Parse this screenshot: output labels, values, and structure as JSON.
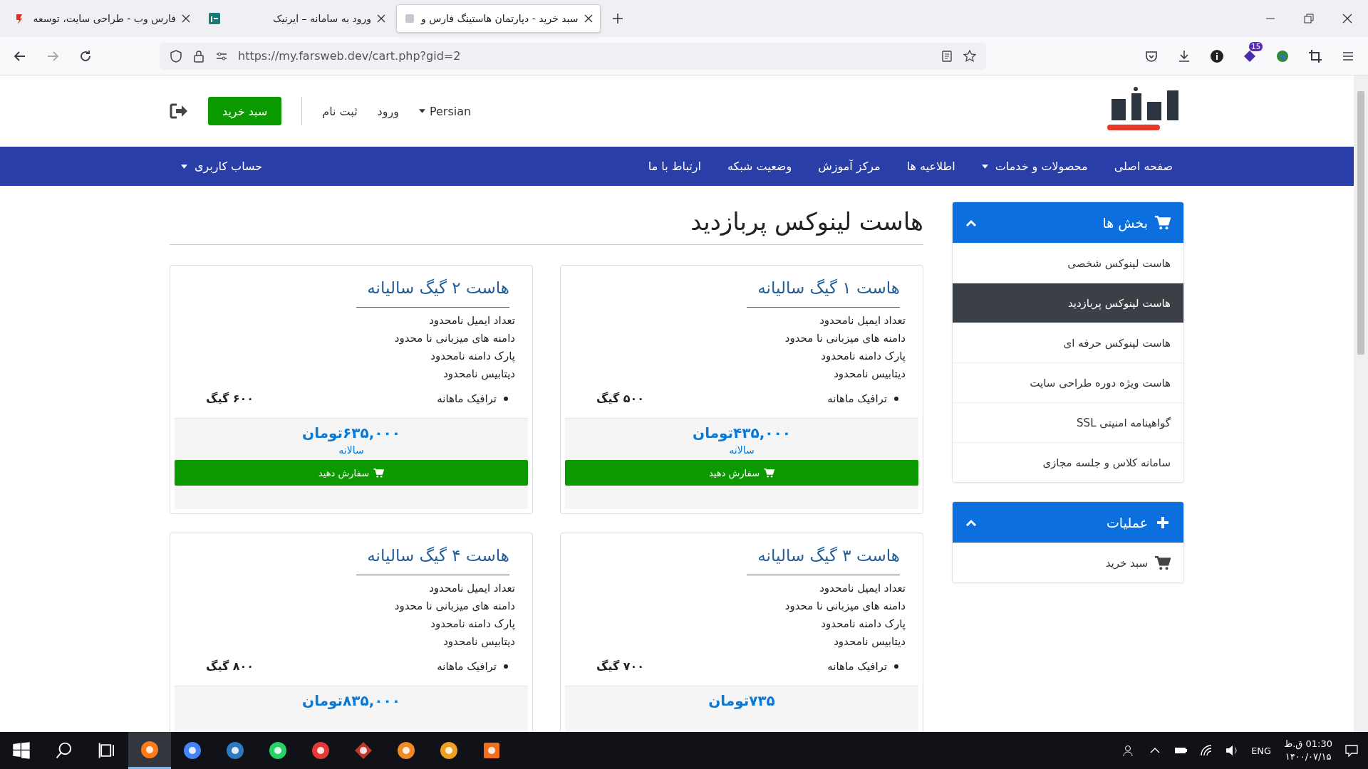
{
  "browser": {
    "tabs": [
      {
        "title": "سبد خرید - دپارتمان هاستینگ فارس و",
        "selected": true
      },
      {
        "title": "ورود به سامانه – ایرنیک",
        "selected": false
      },
      {
        "title": "فارس وب - طراحی سایت، توسعه",
        "selected": false
      }
    ],
    "url": "https://my.farsweb.dev/cart.php?gid=2",
    "extension_badge": "15"
  },
  "header": {
    "language": "Persian",
    "login": "ورود",
    "register": "ثبت نام",
    "cart_button": "سبد خرید"
  },
  "nav": {
    "items": [
      {
        "label": "صفحه اصلی",
        "dropdown": false
      },
      {
        "label": "محصولات و خدمات",
        "dropdown": true
      },
      {
        "label": "اطلاعیه ها",
        "dropdown": false
      },
      {
        "label": "مرکز آموزش",
        "dropdown": false
      },
      {
        "label": "وضعیت شبکه",
        "dropdown": false
      },
      {
        "label": "ارتباط با ما",
        "dropdown": false
      }
    ],
    "account": {
      "label": "حساب کاربری",
      "dropdown": true
    }
  },
  "sidebar": [
    {
      "title": "بخش ها",
      "kind": "cart",
      "items": [
        {
          "label": "هاست لینوکس شخصی",
          "selected": false
        },
        {
          "label": "هاست لینوکس پربازدید",
          "selected": true
        },
        {
          "label": "هاست لینوکس حرفه ای",
          "selected": false
        },
        {
          "label": "هاست ویژه دوره طراحی سایت",
          "selected": false
        },
        {
          "label": "گواهینامه امنیتی SSL",
          "selected": false
        },
        {
          "label": "سامانه کلاس و جلسه مجازی",
          "selected": false
        }
      ]
    },
    {
      "title": "عملیات",
      "kind": "plus",
      "items": [
        {
          "label": "سبد خرید",
          "kind": "cart",
          "selected": false
        }
      ]
    }
  ],
  "page_title": "هاست لینوکس پربازدید",
  "products": [
    {
      "name": "هاست ۱ گیگ سالیانه",
      "features": [
        "تعداد ایمیل نامحدود",
        "دامنه های میزبانی نا محدود",
        "پارک دامنه نامحدود",
        "دیتابیس نامحدود"
      ],
      "traffic_label": "ترافیک ماهانه",
      "traffic_value": "۵۰۰ گیگ",
      "price": "۴۳۵,۰۰۰تومان",
      "cycle": "سالانه",
      "order_button": "سفارش دهید"
    },
    {
      "name": "هاست ۲ گیگ سالیانه",
      "features": [
        "تعداد ایمیل نامحدود",
        "دامنه های میزبانی نا محدود",
        "پارک دامنه نامحدود",
        "دیتابیس نامحدود"
      ],
      "traffic_label": "ترافیک ماهانه",
      "traffic_value": "۶۰۰ گیگ",
      "price": "۶۳۵,۰۰۰تومان",
      "cycle": "سالانه",
      "order_button": "سفارش دهید"
    },
    {
      "name": "هاست ۳ گیگ سالیانه",
      "features": [
        "تعداد ایمیل نامحدود",
        "دامنه های میزبانی نا محدود",
        "پارک دامنه نامحدود",
        "دیتابیس نامحدود"
      ],
      "traffic_label": "ترافیک ماهانه",
      "traffic_value": "۷۰۰ گیگ",
      "price": "۷۳۵تومان"
    },
    {
      "name": "هاست ۴ گیگ سالیانه",
      "features": [
        "تعداد ایمیل نامحدود",
        "دامنه های میزبانی نا محدود",
        "پارک دامنه نامحدود",
        "دیتابیس نامحدود"
      ],
      "traffic_label": "ترافیک ماهانه",
      "traffic_value": "۸۰۰ گیگ",
      "price": "۸۳۵,۰۰۰تومان"
    }
  ],
  "taskbar": {
    "language": "ENG",
    "time": "01:30 ق.ظ",
    "date": "۱۴۰۰/۰۷/۱۵"
  }
}
